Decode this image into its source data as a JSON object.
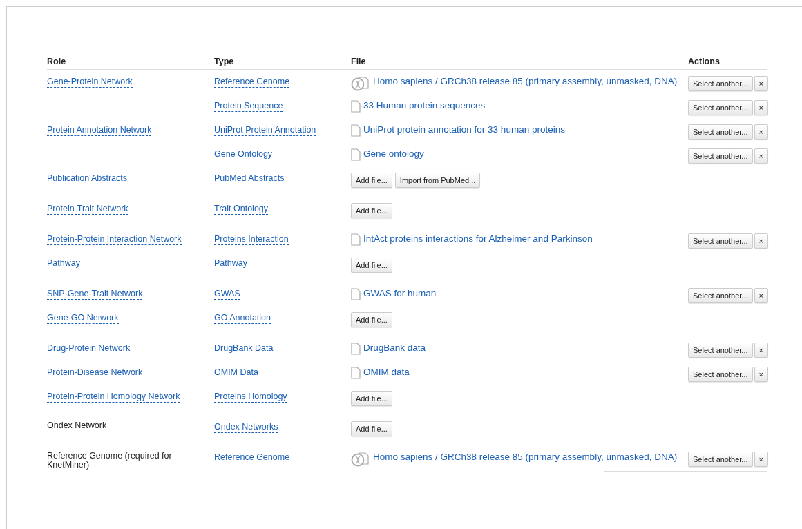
{
  "table": {
    "columns": [
      "Role",
      "Type",
      "File",
      "Actions"
    ],
    "rows": [
      {
        "role": {
          "text": "Gene-Protein Network",
          "kind": "link"
        },
        "type": "Reference Genome",
        "file": {
          "kind": "genome",
          "name": "Homo sapiens / GRCh38 release 85 (primary assembly, unmasked, DNA)"
        },
        "actions": [
          "Select another...",
          "×"
        ]
      },
      {
        "type": "Protein Sequence",
        "file": {
          "kind": "document",
          "name": "33 Human protein sequences"
        },
        "actions": [
          "Select another...",
          "×"
        ]
      },
      {
        "role": {
          "text": "Protein Annotation Network",
          "kind": "link"
        },
        "type": "UniProt Protein Annotation",
        "file": {
          "kind": "document",
          "name": "UniProt protein annotation for 33 human proteins"
        },
        "actions": [
          "Select another...",
          "×"
        ]
      },
      {
        "type": "Gene Ontology",
        "file": {
          "kind": "document",
          "name": "Gene ontology"
        },
        "actions": [
          "Select another...",
          "×"
        ]
      },
      {
        "role": {
          "text": "Publication Abstracts",
          "kind": "link"
        },
        "type": "PubMed Abstracts",
        "file": {
          "kind": "add",
          "buttons": [
            "Add file...",
            "Import from PubMed..."
          ]
        }
      },
      {
        "role": {
          "text": "Protein-Trait Network",
          "kind": "link"
        },
        "type": "Trait Ontology",
        "file": {
          "kind": "add",
          "buttons": [
            "Add file..."
          ]
        }
      },
      {
        "role": {
          "text": "Protein-Protein Interaction Network",
          "kind": "link"
        },
        "type": "Proteins Interaction",
        "file": {
          "kind": "document",
          "name": "IntAct proteins interactions for Alzheimer and Parkinson"
        },
        "actions": [
          "Select another...",
          "×"
        ]
      },
      {
        "role": {
          "text": "Pathway",
          "kind": "link"
        },
        "type": "Pathway",
        "file": {
          "kind": "add",
          "buttons": [
            "Add file..."
          ]
        }
      },
      {
        "role": {
          "text": "SNP-Gene-Trait Network",
          "kind": "link"
        },
        "type": "GWAS",
        "file": {
          "kind": "document",
          "name": "GWAS for human"
        },
        "actions": [
          "Select another...",
          "×"
        ]
      },
      {
        "role": {
          "text": "Gene-GO Network",
          "kind": "link"
        },
        "type": "GO Annotation",
        "file": {
          "kind": "add",
          "buttons": [
            "Add file..."
          ]
        }
      },
      {
        "role": {
          "text": "Drug-Protein Network",
          "kind": "link"
        },
        "type": "DrugBank Data",
        "file": {
          "kind": "document",
          "name": "DrugBank data"
        },
        "actions": [
          "Select another...",
          "×"
        ]
      },
      {
        "role": {
          "text": "Protein-Disease Network",
          "kind": "link"
        },
        "type": "OMIM Data",
        "file": {
          "kind": "document",
          "name": "OMIM data"
        },
        "actions": [
          "Select another...",
          "×"
        ]
      },
      {
        "role": {
          "text": "Protein-Protein Homology Network",
          "kind": "link"
        },
        "type": "Proteins Homology",
        "file": {
          "kind": "add",
          "buttons": [
            "Add file..."
          ]
        }
      },
      {
        "role": {
          "text": "Ondex Network",
          "kind": "text"
        },
        "type": "Ondex Networks",
        "file": {
          "kind": "add",
          "buttons": [
            "Add file..."
          ]
        }
      },
      {
        "role": {
          "text": "Reference Genome (required for KnetMiner)",
          "kind": "text"
        },
        "type": "Reference Genome",
        "file": {
          "kind": "genome",
          "name": "Homo sapiens / GRCh38 release 85 (primary assembly, unmasked, DNA)"
        },
        "actions": [
          "Select another...",
          "×"
        ]
      }
    ]
  }
}
